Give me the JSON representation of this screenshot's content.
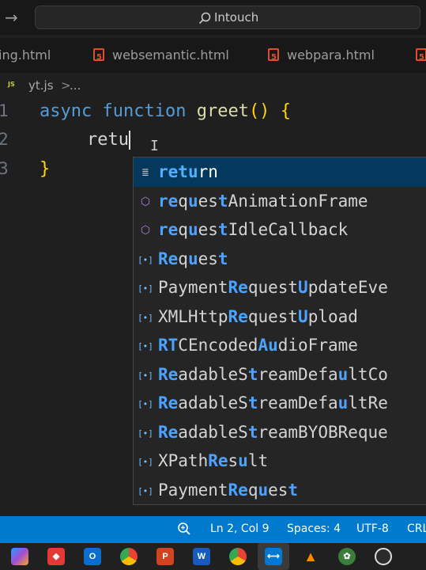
{
  "titlebar": {
    "search_text": "Intouch"
  },
  "tabs": [
    {
      "label": "ing.html"
    },
    {
      "label": "websemantic.html"
    },
    {
      "label": "webpara.html"
    }
  ],
  "breadcrumb": {
    "file": "yt.js",
    "separator": ">",
    "more": "..."
  },
  "editor": {
    "line_numbers": [
      "1",
      "2",
      "3"
    ],
    "line1": {
      "kw1": "async",
      "kw2": "function",
      "name": "greet",
      "parens": "()",
      "brace": "{"
    },
    "line2": {
      "text": "retu"
    },
    "line3": {
      "brace": "}"
    }
  },
  "suggestions": [
    {
      "icon": "keyword-icon",
      "parts": [
        [
          "ret",
          1
        ],
        [
          "u",
          1
        ],
        [
          "rn",
          0
        ]
      ],
      "selected": true
    },
    {
      "icon": "method-icon",
      "parts": [
        [
          "re",
          1
        ],
        [
          "q",
          0
        ],
        [
          "u",
          1
        ],
        [
          "es",
          0
        ],
        [
          "t",
          1
        ],
        [
          "AnimationFrame",
          0
        ]
      ]
    },
    {
      "icon": "method-icon",
      "parts": [
        [
          "re",
          1
        ],
        [
          "q",
          0
        ],
        [
          "u",
          1
        ],
        [
          "es",
          0
        ],
        [
          "t",
          1
        ],
        [
          "IdleCallback",
          0
        ]
      ]
    },
    {
      "icon": "variable-icon",
      "parts": [
        [
          "Re",
          1
        ],
        [
          "q",
          0
        ],
        [
          "u",
          1
        ],
        [
          "es",
          0
        ],
        [
          "t",
          1
        ]
      ]
    },
    {
      "icon": "variable-icon",
      "parts": [
        [
          "Payment",
          0
        ],
        [
          "Re",
          1
        ],
        [
          "quest",
          0
        ],
        [
          "U",
          1
        ],
        [
          "pdateEve",
          0
        ]
      ]
    },
    {
      "icon": "variable-icon",
      "parts": [
        [
          "XMLHttp",
          0
        ],
        [
          "Re",
          1
        ],
        [
          "quest",
          0
        ],
        [
          "U",
          1
        ],
        [
          "pload",
          0
        ]
      ]
    },
    {
      "icon": "variable-icon",
      "parts": [
        [
          "RT",
          1
        ],
        [
          "CEncoded",
          0
        ],
        [
          "Au",
          1
        ],
        [
          "dioFrame",
          0
        ]
      ]
    },
    {
      "icon": "variable-icon",
      "parts": [
        [
          "Re",
          1
        ],
        [
          "adableS",
          0
        ],
        [
          "t",
          1
        ],
        [
          "reamDefa",
          0
        ],
        [
          "u",
          1
        ],
        [
          "ltCo",
          0
        ]
      ]
    },
    {
      "icon": "variable-icon",
      "parts": [
        [
          "Re",
          1
        ],
        [
          "adableS",
          0
        ],
        [
          "t",
          1
        ],
        [
          "reamDefa",
          0
        ],
        [
          "u",
          1
        ],
        [
          "ltRe",
          0
        ]
      ]
    },
    {
      "icon": "variable-icon",
      "parts": [
        [
          "Re",
          1
        ],
        [
          "adableS",
          0
        ],
        [
          "t",
          1
        ],
        [
          "reamBYOBReque",
          0
        ]
      ]
    },
    {
      "icon": "variable-icon",
      "parts": [
        [
          "XPath",
          0
        ],
        [
          "Re",
          1
        ],
        [
          "s",
          0
        ],
        [
          "u",
          1
        ],
        [
          "lt",
          0
        ]
      ]
    },
    {
      "icon": "variable-icon",
      "parts": [
        [
          "Payment",
          0
        ],
        [
          "Re",
          1
        ],
        [
          "q",
          0
        ],
        [
          "u",
          1
        ],
        [
          "es",
          0
        ],
        [
          "t",
          1
        ]
      ]
    }
  ],
  "statusbar": {
    "position": "Ln 2, Col 9",
    "spaces": "Spaces: 4",
    "encoding": "UTF-8",
    "eol": "CRL"
  },
  "taskbar": {
    "apps": [
      "copilot-icon",
      "anydesk-icon",
      "outlook-icon",
      "chrome-icon",
      "powerpoint-icon",
      "word-icon",
      "chrome-profile-icon",
      "vscode-icon",
      "vlc-icon",
      "settings-icon",
      "obs-icon"
    ]
  },
  "colors": {
    "accent": "#007acc",
    "selection": "#04395e",
    "highlight": "#4da2ff"
  }
}
